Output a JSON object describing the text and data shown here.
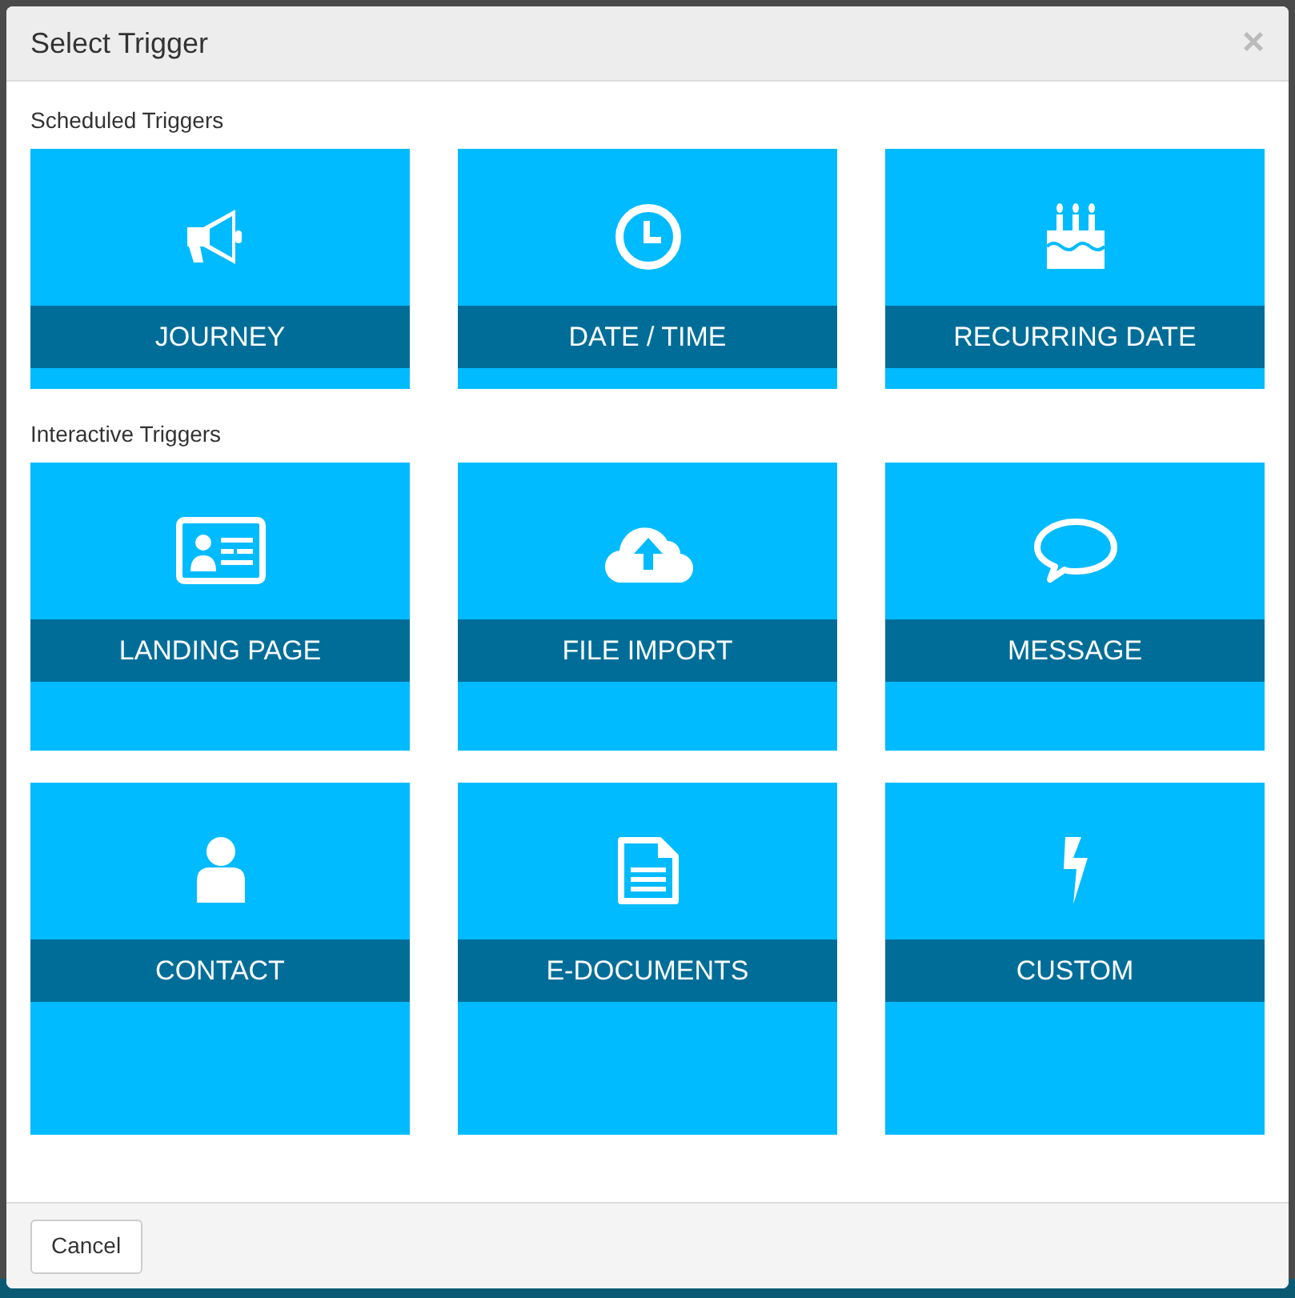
{
  "dialog": {
    "title": "Select Trigger",
    "close": "×"
  },
  "sections": [
    {
      "heading": "Scheduled Triggers",
      "tiles": [
        {
          "label": "JOURNEY"
        },
        {
          "label": "DATE / TIME"
        },
        {
          "label": "RECURRING DATE"
        }
      ]
    },
    {
      "heading": "Interactive Triggers",
      "tiles": [
        {
          "label": "LANDING PAGE"
        },
        {
          "label": "FILE IMPORT"
        },
        {
          "label": "MESSAGE"
        },
        {
          "label": "CONTACT"
        },
        {
          "label": "E-DOCUMENTS"
        },
        {
          "label": "CUSTOM"
        }
      ]
    }
  ],
  "footer": {
    "buttons": [
      "Cancel"
    ]
  }
}
